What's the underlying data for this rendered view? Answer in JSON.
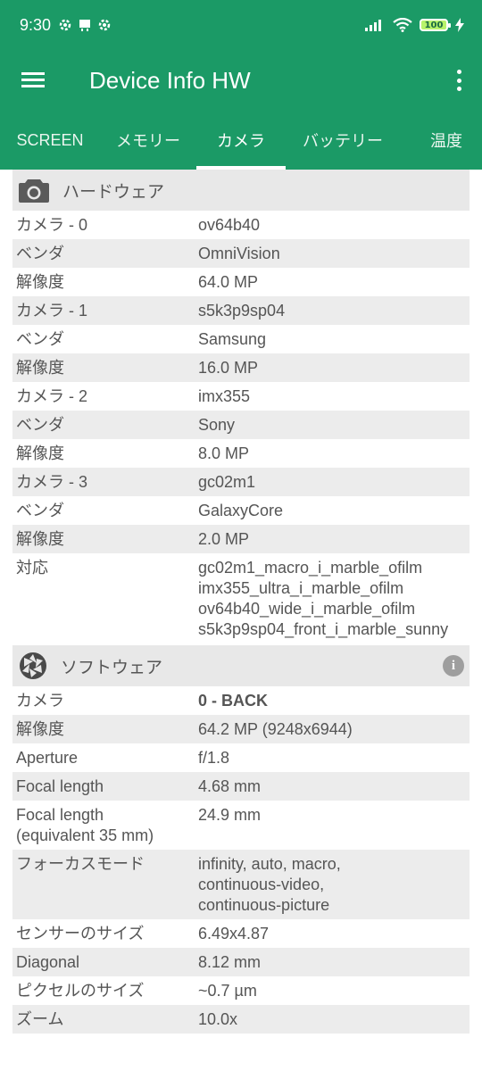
{
  "status_bar": {
    "time": "9:30",
    "battery": "100"
  },
  "app_bar": {
    "title": "Device Info HW"
  },
  "tabs": [
    {
      "label": "SCREEN"
    },
    {
      "label": "メモリー"
    },
    {
      "label": "カメラ"
    },
    {
      "label": "バッテリー"
    },
    {
      "label": "温度"
    }
  ],
  "active_tab": "カメラ",
  "hardware": {
    "title": "ハードウェア",
    "rows": [
      {
        "k": "カメラ - 0",
        "v": "ov64b40"
      },
      {
        "k": "ベンダ",
        "v": "OmniVision"
      },
      {
        "k": "解像度",
        "v": "64.0 MP"
      },
      {
        "k": "カメラ - 1",
        "v": "s5k3p9sp04"
      },
      {
        "k": "ベンダ",
        "v": "Samsung"
      },
      {
        "k": "解像度",
        "v": "16.0 MP"
      },
      {
        "k": "カメラ - 2",
        "v": "imx355"
      },
      {
        "k": "ベンダ",
        "v": "Sony"
      },
      {
        "k": "解像度",
        "v": "8.0 MP"
      },
      {
        "k": "カメラ - 3",
        "v": "gc02m1"
      },
      {
        "k": "ベンダ",
        "v": "GalaxyCore"
      },
      {
        "k": "解像度",
        "v": "2.0 MP"
      },
      {
        "k": "対応",
        "v": "gc02m1_macro_i_marble_ofilm\nimx355_ultra_i_marble_ofilm\nov64b40_wide_i_marble_ofilm\ns5k3p9sp04_front_i_marble_sunny"
      }
    ]
  },
  "software": {
    "title": "ソフトウェア",
    "rows": [
      {
        "k": "カメラ",
        "v": "0 - BACK"
      },
      {
        "k": "解像度",
        "v": "64.2 MP (9248x6944)"
      },
      {
        "k": "Aperture",
        "v": "f/1.8"
      },
      {
        "k": "Focal length",
        "v": "4.68 mm"
      },
      {
        "k": "Focal length\n(equivalent 35 mm)",
        "v": "24.9 mm"
      },
      {
        "k": "フォーカスモード",
        "v": "infinity, auto, macro,\ncontinuous-video,\ncontinuous-picture"
      },
      {
        "k": "センサーのサイズ",
        "v": "6.49x4.87"
      },
      {
        "k": "Diagonal",
        "v": "8.12 mm"
      },
      {
        "k": "ピクセルのサイズ",
        "v": "~0.7 µm"
      },
      {
        "k": "ズーム",
        "v": "10.0x"
      }
    ]
  },
  "colors": {
    "primary": "#1b9a66",
    "row_alt": "#ececec",
    "header_bg": "#e8e8e8"
  }
}
